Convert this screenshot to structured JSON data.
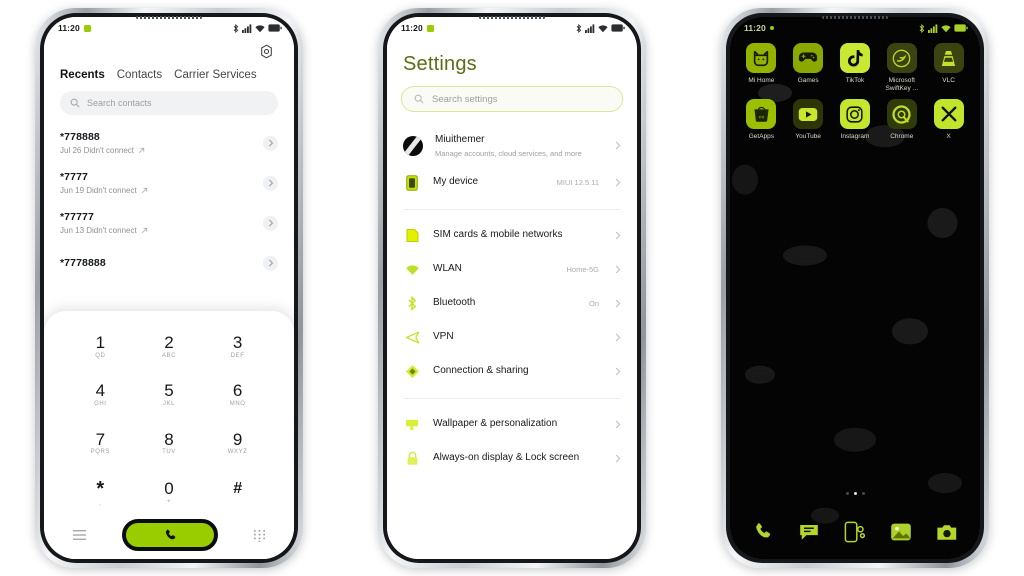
{
  "theme": {
    "accent": "#9acd00",
    "accent_dark": "#5f6b16",
    "wallpaper": "black-cracked-marble"
  },
  "phone_dialer": {
    "status_bar": {
      "time": "11:20",
      "icons": [
        "notification-badge-icon",
        "bluetooth-icon",
        "signal-icon",
        "wifi-icon",
        "battery-icon"
      ]
    },
    "settings_gear": "gear-icon",
    "tabs": [
      {
        "label": "Recents",
        "active": true
      },
      {
        "label": "Contacts",
        "active": false
      },
      {
        "label": "Carrier Services",
        "active": false
      }
    ],
    "search": {
      "placeholder": "Search contacts",
      "icon": "search-icon"
    },
    "calls": [
      {
        "number": "*778888",
        "detail": "Jul 26 Didn't connect",
        "arrow": "outgoing-arrow-icon"
      },
      {
        "number": "*7777",
        "detail": "Jun 19 Didn't connect",
        "arrow": "outgoing-arrow-icon"
      },
      {
        "number": "*77777",
        "detail": "Jun 13 Didn't connect",
        "arrow": "outgoing-arrow-icon"
      },
      {
        "number": "*7778888",
        "detail": "",
        "arrow": "outgoing-arrow-icon"
      }
    ],
    "keypad": [
      {
        "digit": "1",
        "letters": "QD"
      },
      {
        "digit": "2",
        "letters": "ABC"
      },
      {
        "digit": "3",
        "letters": "DEF"
      },
      {
        "digit": "4",
        "letters": "GHI"
      },
      {
        "digit": "5",
        "letters": "JKL"
      },
      {
        "digit": "6",
        "letters": "MNO"
      },
      {
        "digit": "7",
        "letters": "PQRS"
      },
      {
        "digit": "8",
        "letters": "TUV"
      },
      {
        "digit": "9",
        "letters": "WXYZ"
      },
      {
        "digit": "*",
        "letters": ","
      },
      {
        "digit": "0",
        "letters": "+"
      },
      {
        "digit": "#",
        "letters": ""
      }
    ],
    "action_bar": {
      "left_icon": "menu-lines-icon",
      "call_icon": "phone-handset-icon",
      "right_icon": "keypad-grid-icon"
    }
  },
  "phone_settings": {
    "status_bar": {
      "time": "11:20",
      "icons": [
        "notification-badge-icon",
        "bluetooth-icon",
        "signal-icon",
        "wifi-icon",
        "battery-icon"
      ]
    },
    "title": "Settings",
    "search": {
      "placeholder": "Search settings",
      "icon": "search-icon"
    },
    "groups": [
      {
        "items": [
          {
            "label": "Miuithemer",
            "desc": "Manage accounts, cloud services, and more",
            "value": "",
            "icon": "account-avatar-icon"
          },
          {
            "label": "My device",
            "desc": "",
            "value": "MIUI 12.5.11",
            "icon": "device-icon"
          }
        ]
      },
      {
        "items": [
          {
            "label": "SIM cards & mobile networks",
            "desc": "",
            "value": "",
            "icon": "sim-card-icon"
          },
          {
            "label": "WLAN",
            "desc": "",
            "value": "Home-5G",
            "icon": "wifi-icon"
          },
          {
            "label": "Bluetooth",
            "desc": "",
            "value": "On",
            "icon": "bluetooth-icon"
          },
          {
            "label": "VPN",
            "desc": "",
            "value": "",
            "icon": "vpn-icon"
          },
          {
            "label": "Connection & sharing",
            "desc": "",
            "value": "",
            "icon": "connection-sharing-icon"
          }
        ]
      },
      {
        "items": [
          {
            "label": "Wallpaper & personalization",
            "desc": "",
            "value": "",
            "icon": "wallpaper-icon"
          },
          {
            "label": "Always-on display & Lock screen",
            "desc": "",
            "value": "",
            "icon": "lock-icon"
          }
        ]
      }
    ]
  },
  "phone_home": {
    "status_bar": {
      "time": "11:20",
      "icons": [
        "notification-badge-icon",
        "bluetooth-icon",
        "signal-icon",
        "wifi-icon",
        "battery-icon"
      ]
    },
    "app_rows": [
      [
        {
          "label": "Mi Home",
          "icon": "mi-home-icon"
        },
        {
          "label": "Games",
          "icon": "gamepad-icon"
        },
        {
          "label": "TikTok",
          "icon": "tiktok-icon"
        },
        {
          "label": "Microsoft SwiftKey ...",
          "icon": "swiftkey-icon"
        },
        {
          "label": "VLC",
          "icon": "vlc-cone-icon"
        }
      ],
      [
        {
          "label": "GetApps",
          "icon": "getapps-bag-icon"
        },
        {
          "label": "YouTube",
          "icon": "youtube-icon"
        },
        {
          "label": "Instagram",
          "icon": "instagram-icon"
        },
        {
          "label": "Chrome",
          "icon": "chrome-icon"
        },
        {
          "label": "X",
          "icon": "x-twitter-icon"
        }
      ]
    ],
    "page_dots": {
      "count": 3,
      "active_index": 1
    },
    "dock": [
      {
        "name": "Phone",
        "icon": "phone-handset-icon"
      },
      {
        "name": "Messages",
        "icon": "message-bubble-icon"
      },
      {
        "name": "Settings",
        "icon": "settings-app-icon"
      },
      {
        "name": "Gallery",
        "icon": "gallery-photo-icon"
      },
      {
        "name": "Camera",
        "icon": "camera-icon"
      }
    ]
  }
}
